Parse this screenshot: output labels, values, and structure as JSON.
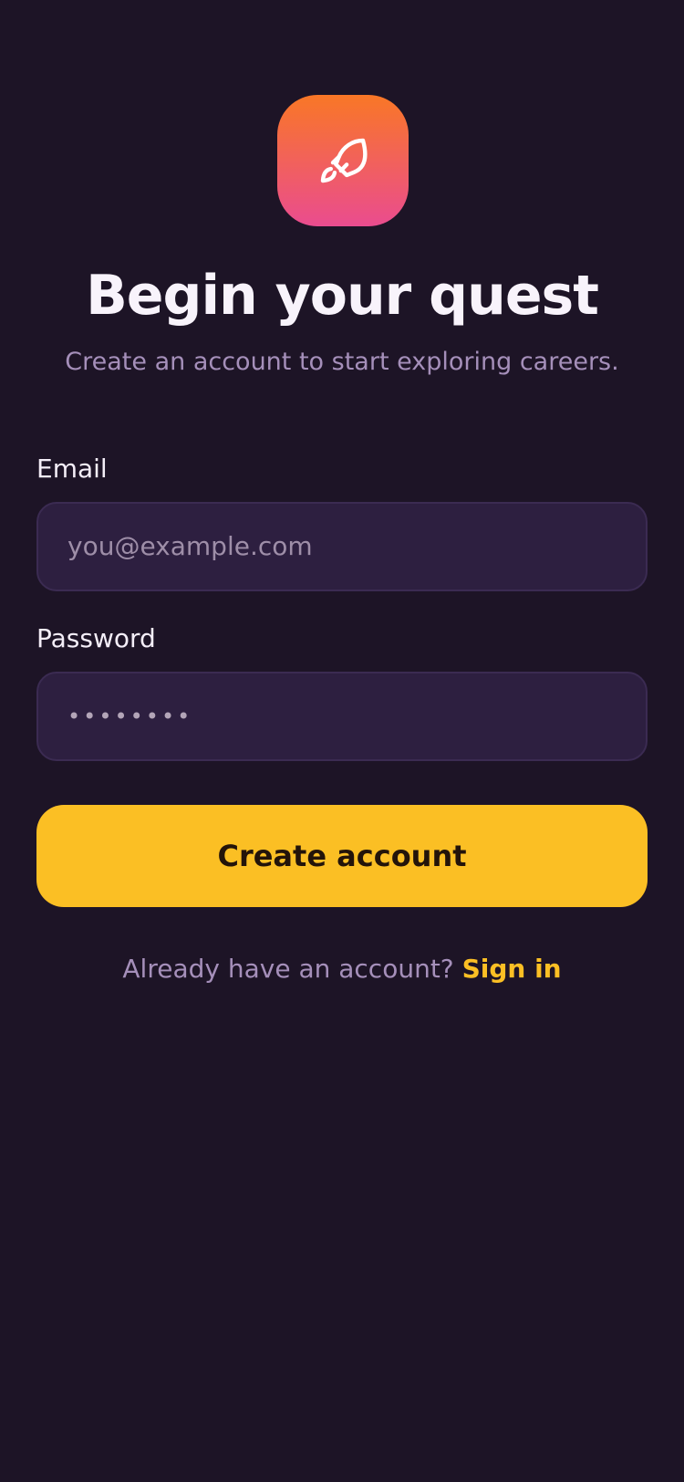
{
  "app_icon": {
    "name": "rocket-icon",
    "gradient_top": "#f97726",
    "gradient_bottom": "#ea4c8f"
  },
  "header": {
    "title": "Begin your quest",
    "subtitle": "Create an account to start exploring careers."
  },
  "form": {
    "email": {
      "label": "Email",
      "placeholder": "you@example.com"
    },
    "password": {
      "label": "Password",
      "masked_value": "••••••••"
    },
    "submit_label": "Create account"
  },
  "footer": {
    "prompt": "Already have an account?",
    "link_label": "Sign in"
  },
  "colors": {
    "background": "#1d1426",
    "input_background": "#2d1f40",
    "accent": "#fbbf24",
    "muted_text": "#a58fba"
  }
}
